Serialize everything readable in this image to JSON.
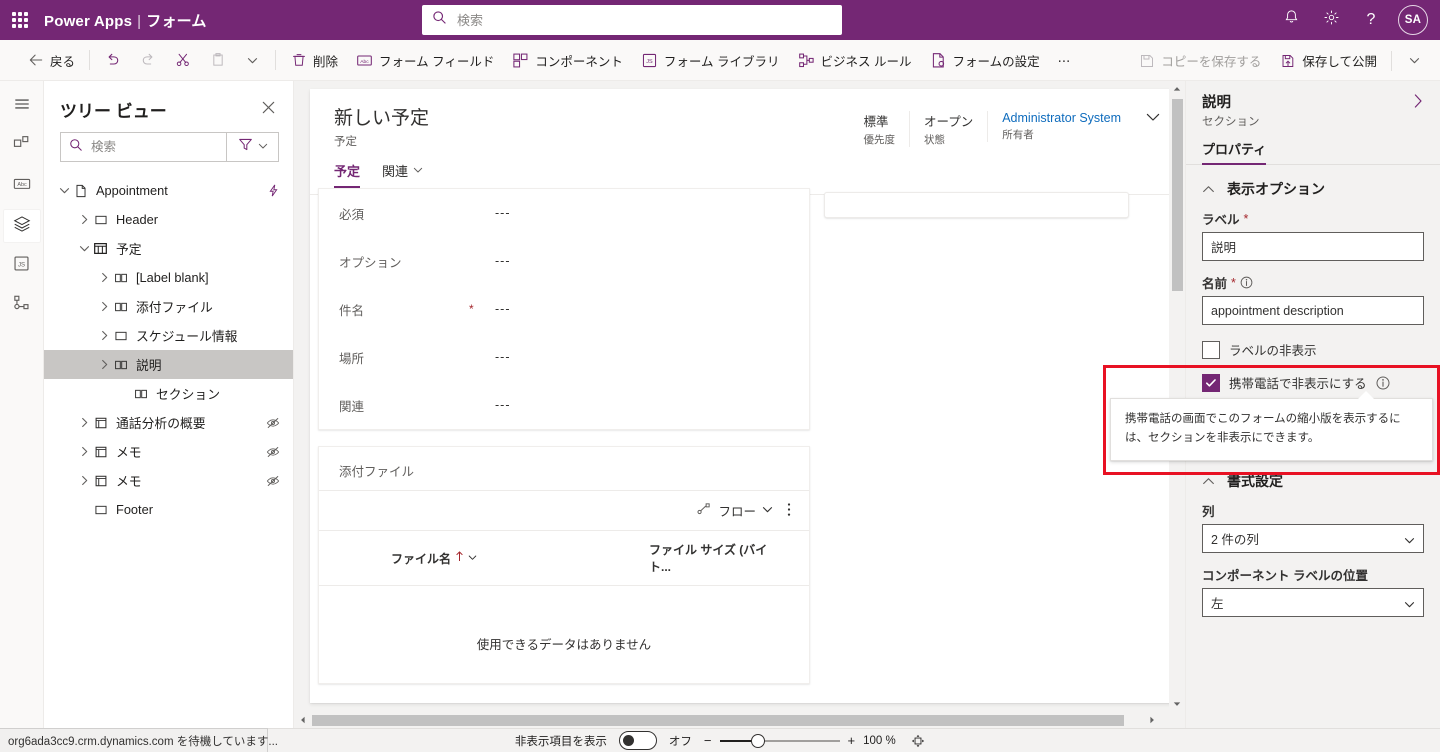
{
  "topbar": {
    "waffle_label": "app-launcher",
    "brand": "Power Apps",
    "brand_separator": "|",
    "brand_sub": "フォーム",
    "search_placeholder": "検索",
    "avatar_initials": "SA"
  },
  "commandbar": {
    "back": "戻る",
    "delete": "削除",
    "form_fields": "フォーム フィールド",
    "components": "コンポーネント",
    "form_libraries": "フォーム ライブラリ",
    "business_rules": "ビジネス ルール",
    "form_settings": "フォームの設定",
    "overflow": "⋯",
    "save_copy": "コピーを保存する",
    "save_publish": "保存して公開"
  },
  "tree": {
    "title": "ツリー ビュー",
    "search_placeholder": "検索",
    "nodes": [
      {
        "label": "Appointment",
        "depth": 0,
        "icon": "form-icon",
        "chevron": "down",
        "selected": false,
        "action_icon": "flash-icon"
      },
      {
        "label": "Header",
        "depth": 1,
        "icon": "region-icon",
        "chevron": "right",
        "selected": false,
        "action_icon": ""
      },
      {
        "label": "予定",
        "depth": 1,
        "icon": "tab-icon",
        "chevron": "down",
        "selected": false,
        "action_icon": ""
      },
      {
        "label": "[Label blank]",
        "depth": 2,
        "icon": "section-icon",
        "chevron": "right",
        "selected": false,
        "action_icon": ""
      },
      {
        "label": "添付ファイル",
        "depth": 2,
        "icon": "section-icon",
        "chevron": "right",
        "selected": false,
        "action_icon": ""
      },
      {
        "label": "スケジュール情報",
        "depth": 2,
        "icon": "region-icon",
        "chevron": "right",
        "selected": false,
        "action_icon": ""
      },
      {
        "label": "説明",
        "depth": 2,
        "icon": "section-icon",
        "chevron": "right",
        "selected": true,
        "action_icon": ""
      },
      {
        "label": "セクション",
        "depth": 3,
        "icon": "section-icon",
        "chevron": "none",
        "selected": false,
        "action_icon": ""
      },
      {
        "label": "通話分析の概要",
        "depth": 1,
        "icon": "tab-icon2",
        "chevron": "right",
        "selected": false,
        "action_icon": "hidden-eye-icon"
      },
      {
        "label": "メモ",
        "depth": 1,
        "icon": "tab-icon2",
        "chevron": "right",
        "selected": false,
        "action_icon": "hidden-eye-icon"
      },
      {
        "label": "メモ",
        "depth": 1,
        "icon": "tab-icon2",
        "chevron": "right",
        "selected": false,
        "action_icon": "hidden-eye-icon"
      },
      {
        "label": "Footer",
        "depth": 1,
        "icon": "region-icon",
        "chevron": "none",
        "selected": false,
        "action_icon": ""
      }
    ]
  },
  "canvas": {
    "record_title": "新しい予定",
    "record_subtitle": "予定",
    "header_fields": [
      {
        "value": "標準",
        "label": "優先度",
        "link": false
      },
      {
        "value": "オープン",
        "label": "状態",
        "link": false
      },
      {
        "value": "Administrator System",
        "label": "所有者",
        "link": true
      }
    ],
    "tabs": [
      {
        "label": "予定",
        "active": true,
        "caret": false
      },
      {
        "label": "関連",
        "active": false,
        "caret": true
      }
    ],
    "fields": [
      {
        "label": "必須",
        "required": false,
        "value": "---"
      },
      {
        "label": "オプション",
        "required": false,
        "value": "---"
      },
      {
        "label": "件名",
        "required": true,
        "value": "---"
      },
      {
        "label": "場所",
        "required": false,
        "value": "---"
      },
      {
        "label": "関連",
        "required": false,
        "value": "---"
      }
    ],
    "attachments": {
      "section_title": "添付ファイル",
      "flow_label": "フロー",
      "col_filename": "ファイル名",
      "col_filesize": "ファイル サイズ (バイト...",
      "empty_text": "使用できるデータはありません"
    }
  },
  "properties": {
    "title": "説明",
    "subtitle": "セクション",
    "tab": "プロパティ",
    "display_group": "表示オプション",
    "label_field_label": "ラベル",
    "label_field_value": "説明",
    "name_field_label": "名前",
    "name_field_value": "appointment description",
    "hide_label_checkbox": "ラベルの非表示",
    "hide_label_checked": false,
    "hide_phone_checkbox": "携帯電話で非表示にする",
    "hide_phone_checked": true,
    "tooltip_text": "携帯電話の画面でこのフォームの縮小版を表示するには、セクションを非表示にできます。",
    "format_group": "書式設定",
    "columns_label": "列",
    "columns_value": "2 件の列",
    "label_position_label": "コンポーネント ラベルの位置",
    "label_position_value": "左"
  },
  "statusbar": {
    "show_hidden_label": "非表示項目を表示",
    "toggle_state": "オフ",
    "zoom_minus": "−",
    "zoom_plus": "+",
    "zoom_value": "100 %",
    "url_status": "org6ada3cc9.crm.dynamics.com を待機しています..."
  },
  "colors": {
    "brand_purple": "#742774",
    "accent_link": "#0f6cbd",
    "required_red": "#a4262c",
    "callout_red": "#e81123"
  }
}
